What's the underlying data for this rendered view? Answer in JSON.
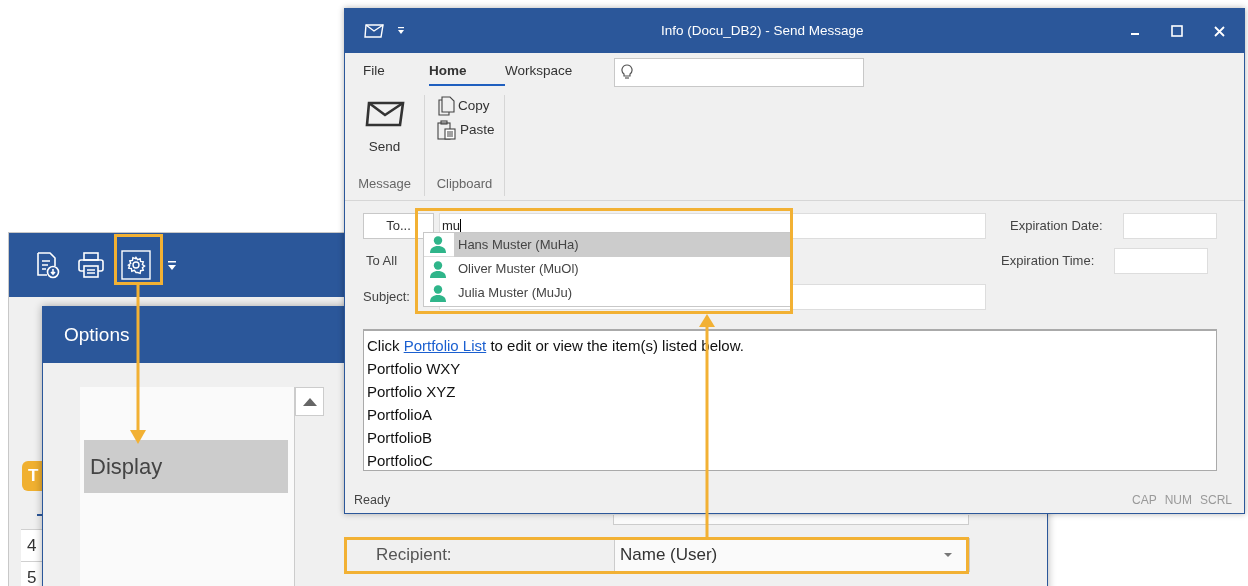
{
  "back_window": {
    "badge": "T",
    "row_numbers": [
      "4",
      "5"
    ]
  },
  "options_dialog": {
    "title": "Options",
    "list_items": [
      {
        "label": "Display",
        "selected": true
      }
    ]
  },
  "recipient": {
    "label": "Recipient:",
    "value": "Name (User)"
  },
  "message_window": {
    "title": "Info (Docu_DB2) - Send Message",
    "tabs": [
      {
        "label": "File",
        "selected": false
      },
      {
        "label": "Home",
        "selected": true
      },
      {
        "label": "Workspace",
        "selected": false
      }
    ],
    "ribbon_groups": [
      {
        "name": "Message",
        "buttons": [
          "Send"
        ]
      },
      {
        "name": "Clipboard",
        "buttons": [
          "Copy",
          "Paste"
        ]
      }
    ],
    "to_button": "To...",
    "to_value": "mu",
    "to_all": "To All",
    "subject_label": "Subject:",
    "expiration_date_label": "Expiration Date:",
    "expiration_time_label": "Expiration Time:",
    "suggestions": [
      {
        "name": "Hans Muster (MuHa)",
        "selected": true
      },
      {
        "name": "Oliver Muster (MuOl)",
        "selected": false
      },
      {
        "name": "Julia Muster (MuJu)",
        "selected": false
      }
    ],
    "body": {
      "intro_before": "Click",
      "intro_link": "Portfolio List",
      "intro_after": "to edit or view the item(s) listed below.",
      "lines": [
        "Portfolio WXY",
        "Portfolio XYZ",
        "PortfolioA",
        "PortfolioB",
        "PortfolioC"
      ]
    },
    "status_bar": {
      "text": "Ready",
      "indicators": [
        "CAP",
        "NUM",
        "SCRL"
      ]
    }
  }
}
